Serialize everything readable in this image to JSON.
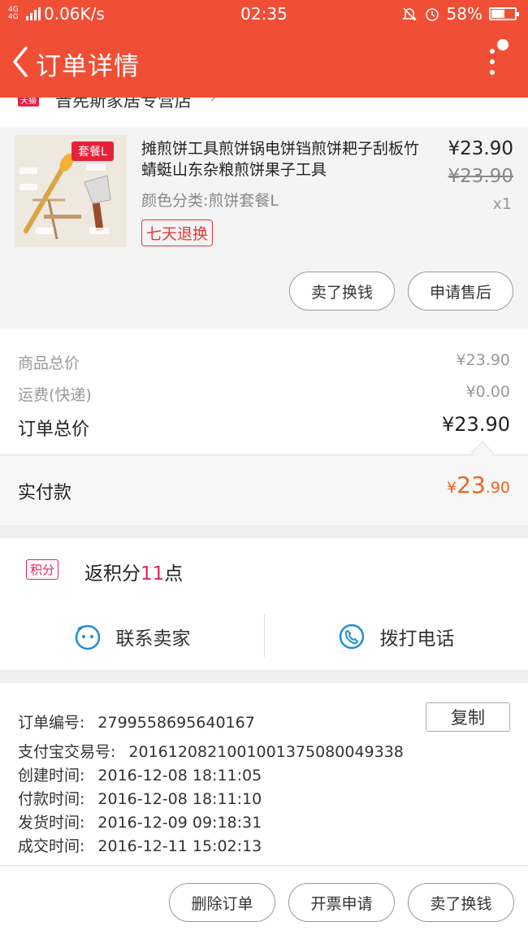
{
  "status_bar": {
    "network_type": "4G 4G",
    "speed": "0.06K/s",
    "time": "02:35",
    "battery": "58%",
    "battery_level": 0.58
  },
  "header": {
    "title": "订单详情"
  },
  "shop": {
    "badge": "天猫",
    "name": "晋宪斯家居专营店"
  },
  "product": {
    "thumb_tag": "套餐L",
    "title": "摊煎饼工具煎饼锅电饼铛煎饼耙子刮板竹蜻蜓山东杂粮煎饼果子工具",
    "sku": "颜色分类:煎饼套餐L",
    "refund_tag": "七天退换",
    "price": "¥23.90",
    "original_price": "¥23.90",
    "quantity": "x1",
    "buttons": [
      "卖了换钱",
      "申请售后"
    ]
  },
  "summary": {
    "goods_total_label": "商品总价",
    "goods_total": "¥23.90",
    "shipping_label": "运费(快递)",
    "shipping": "¥0.00",
    "order_total_label": "订单总价",
    "order_total": "¥23.90",
    "paid_label": "实付款",
    "paid_currency": "¥",
    "paid_int": "23",
    "paid_dec": ".90"
  },
  "points": {
    "badge": "积分",
    "prefix": "返积分",
    "value": "11",
    "suffix": "点"
  },
  "contact": {
    "seller": "联系卖家",
    "phone": "拨打电话"
  },
  "order_info": {
    "order_no_label": "订单编号:",
    "order_no": "2799558695640167",
    "copy": "复制",
    "alipay_label": "支付宝交易号:",
    "alipay_no": "2016120821001001375080049338",
    "created_label": "创建时间:",
    "created": "2016-12-08 18:11:05",
    "paid_label": "付款时间:",
    "paid": "2016-12-08 18:11:10",
    "shipped_label": "发货时间:",
    "shipped": "2016-12-09 09:18:31",
    "completed_label": "成交时间:",
    "completed": "2016-12-11 15:02:13"
  },
  "footer": {
    "buttons": [
      "删除订单",
      "开票申请",
      "卖了换钱"
    ]
  },
  "colors": {
    "brand": "#f04f35",
    "accent_price": "#f26322",
    "points": "#e0245a"
  }
}
